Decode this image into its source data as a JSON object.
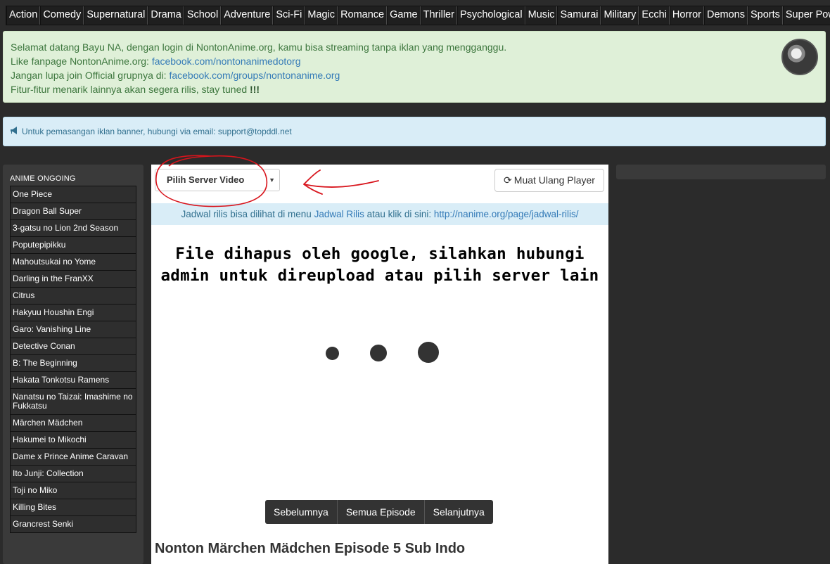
{
  "genres": [
    "Action",
    "Comedy",
    "Supernatural",
    "Drama",
    "School",
    "Adventure",
    "Sci-Fi",
    "Magic",
    "Romance",
    "Game",
    "Thriller",
    "Psychological",
    "Music",
    "Samurai",
    "Military",
    "Ecchi",
    "Horror",
    "Demons",
    "Sports",
    "Super Power"
  ],
  "welcome": {
    "line1": "Selamat datang Bayu NA, dengan login di NontonAnime.org, kamu bisa streaming tanpa iklan yang mengganggu.",
    "line2_prefix": "Like fanpage NontonAnime.org: ",
    "line2_link": "facebook.com/nontonanimedotorg",
    "line3_prefix": "Jangan lupa join Official grupnya di: ",
    "line3_link": "facebook.com/groups/nontonanime.org",
    "line4_prefix": "Fitur-fitur menarik lainnya akan segera rilis, stay tuned ",
    "line4_bold": "!!!"
  },
  "info_banner": {
    "icon": "megaphone-icon",
    "text": "Untuk pemasangan iklan banner, hubungi via email: support@topddl.net"
  },
  "sidebar": {
    "title": "ANIME ONGOING",
    "items": [
      "One Piece",
      "Dragon Ball Super",
      "3-gatsu no Lion 2nd Season",
      "Poputepipikku",
      "Mahoutsukai no Yome",
      "Darling in the FranXX",
      "Citrus",
      "Hakyuu Houshin Engi",
      "Garo: Vanishing Line",
      "Detective Conan",
      "B: The Beginning",
      "Hakata Tonkotsu Ramens",
      "Nanatsu no Taizai: Imashime no Fukkatsu",
      "Märchen Mädchen",
      "Hakumei to Mikochi",
      "Dame x Prince Anime Caravan",
      "Ito Junji: Collection",
      "Toji no Miko",
      "Killing Bites",
      "Grancrest Senki"
    ]
  },
  "main": {
    "server_select": "Pilih Server Video",
    "reload_label": "Muat Ulang Player",
    "reload_icon": "refresh-icon",
    "schedule_prefix": "Jadwal rilis bisa dilihat di menu ",
    "schedule_link1": "Jadwal Rilis",
    "schedule_mid": " atau klik di sini: ",
    "schedule_link2": "http://nanime.org/page/jadwal-rilis/",
    "player_msg_line1": "File dihapus oleh google, silahkan hubungi",
    "player_msg_line2": "admin untuk direupload atau pilih server lain",
    "nav_prev": "Sebelumnya",
    "nav_all": "Semua Episode",
    "nav_next": "Selanjutnya",
    "title": "Nonton Märchen Mädchen Episode 5 Sub Indo"
  },
  "colors": {
    "annotation": "#d8141c",
    "page_bg": "#2b2b2b"
  }
}
